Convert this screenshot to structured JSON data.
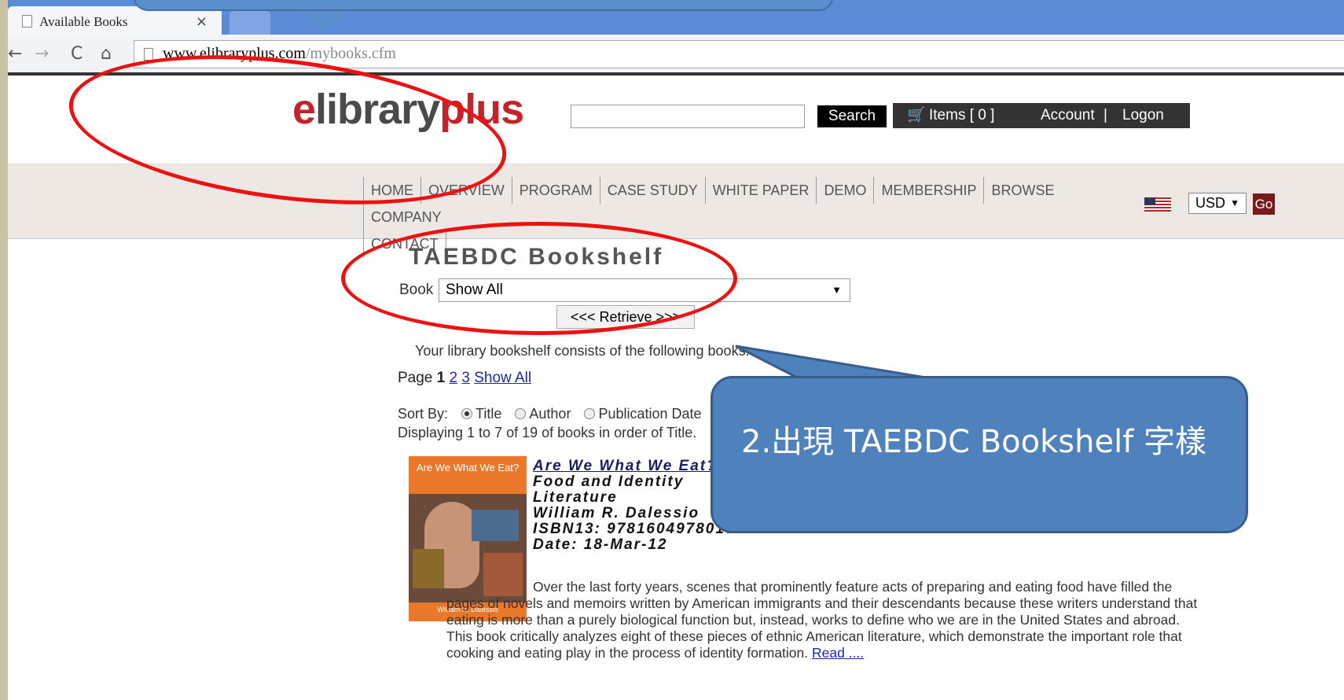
{
  "browser": {
    "tab_title": "Available Books",
    "tab_close": "×",
    "url_host": "www.elibraryplus.com",
    "url_path": "/mybooks.cfm"
  },
  "site": {
    "logo_prefix": "e",
    "logo_text": "library",
    "logo_suffix": "plus",
    "search_button": "Search",
    "cart_label": "Items [ 0 ]",
    "account_label": "Account",
    "separator": "|",
    "logon_label": "Logon",
    "menu": [
      "HOME",
      "OVERVIEW",
      "PROGRAM",
      "CASE STUDY",
      "WHITE PAPER",
      "DEMO",
      "MEMBERSHIP",
      "BROWSE",
      "COMPANY",
      "CONTACT"
    ],
    "currency": "USD",
    "go_button": "Go"
  },
  "bookshelf": {
    "title": "TAEBDC Bookshelf",
    "book_label": "Book",
    "book_select_value": "Show All",
    "retrieve_button": "<<< Retrieve >>>",
    "intro": "Your library bookshelf consists of the following books:",
    "pager_label": "Page",
    "current_page": "1",
    "pages": [
      "2",
      "3"
    ],
    "show_all": "Show All",
    "sort_label": "Sort By:",
    "sort_options": [
      "Title",
      "Author",
      "Publication Date"
    ],
    "displaying": "Displaying 1 to 7 of 19 of books in order of Title."
  },
  "book": {
    "cover_title": "Are We What We Eat?",
    "cover_author": "William R. Dalessio",
    "title": "Are We What We Eat?",
    "subtitle": "Food and Identity",
    "category": "Literature",
    "author": "William R. Dalessio",
    "isbn": "ISBN13: 9781604978018",
    "date": "Date: 18-Mar-12",
    "description": "Over the last forty years, scenes that prominently feature acts of preparing and eating food have filled the pages of novels and memoirs written by American immigrants and their descendants because these writers understand that eating is more than a purely biological function but, instead, works to define who we are in the United States and abroad. This book critically analyzes eight of these pieces of ethnic American literature, which demonstrate the important role that cooking and eating play in the process of identity formation.",
    "read_more": "Read ...."
  },
  "annotation": {
    "callout_text": "2.出現 TAEBDC Bookshelf 字樣",
    "highlight_color": "#ee1111",
    "callout_color": "#4f81bd"
  }
}
